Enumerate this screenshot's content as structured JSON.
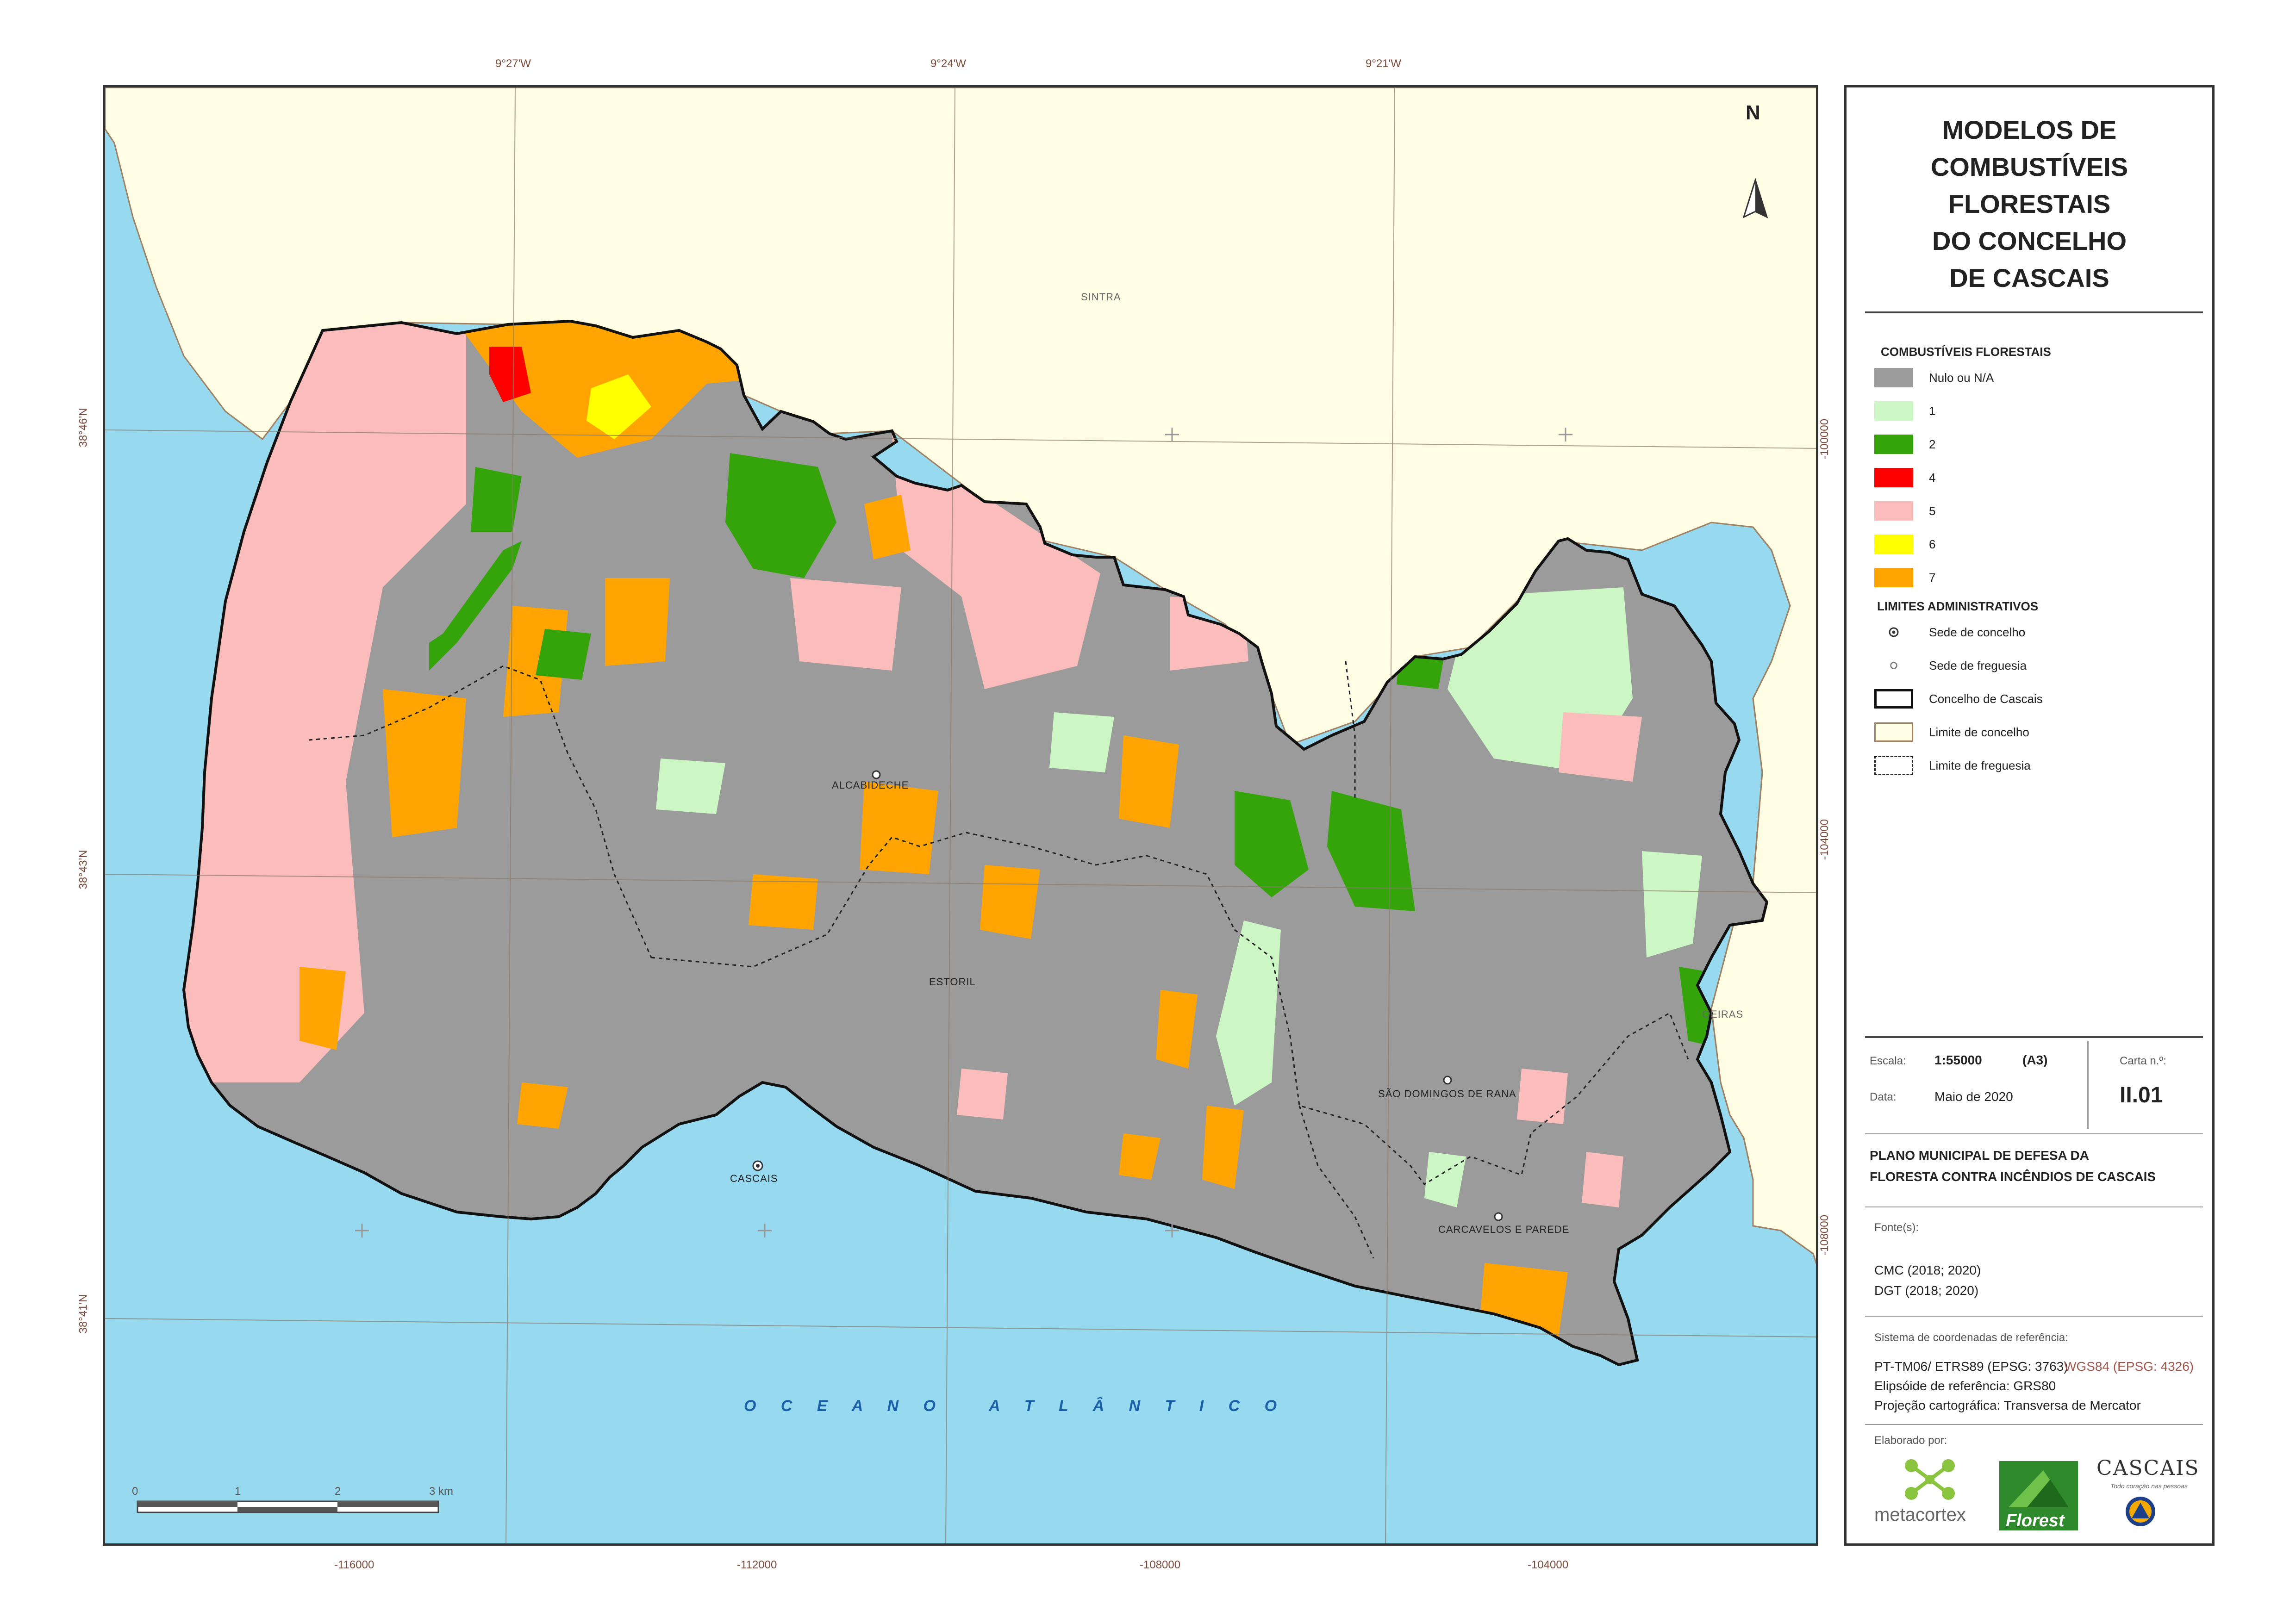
{
  "title_lines": [
    "MODELOS DE",
    "COMBUSTÍVEIS",
    "FLORESTAIS",
    "DO CONCELHO",
    "DE CASCAIS"
  ],
  "north_label": "N",
  "graticule": {
    "top_labels": [
      "9°27'W",
      "9°24'W",
      "9°21'W"
    ],
    "left_labels": [
      "38°46'N",
      "38°43'N",
      "38°41'N"
    ],
    "bottom_labels": [
      "-116000",
      "-112000",
      "-108000",
      "-104000"
    ],
    "right_labels": [
      "-100000",
      "-104000",
      "-108000"
    ]
  },
  "places": {
    "sintra": "SINTRA",
    "oeiras": "OEIRAS",
    "ocean": "O C E A N O   A T L Â N T I C O",
    "alcabideche": "ALCABIDECHE",
    "estoril": "ESTORIL",
    "cascais": "CASCAIS",
    "sao_domingos": "SÃO DOMINGOS DE RANA",
    "carcavelos": "CARCAVELOS E PAREDE"
  },
  "scalebar": {
    "ticks": [
      "0",
      "1",
      "2",
      "3 km"
    ]
  },
  "legend": {
    "fuel_header": "COMBUSTÍVEIS FLORESTAIS",
    "fuel_items": [
      {
        "label": "Nulo ou N/A",
        "color": "#9b9b9b"
      },
      {
        "label": "1",
        "color": "#ccf7c4"
      },
      {
        "label": "2",
        "color": "#35a30a"
      },
      {
        "label": "4",
        "color": "#ff0000"
      },
      {
        "label": "5",
        "color": "#fbbcbc"
      },
      {
        "label": "6",
        "color": "#ffff00"
      },
      {
        "label": "7",
        "color": "#ffa400"
      }
    ],
    "admin_header": "LIMITES ADMINISTRATIVOS",
    "admin_items": [
      {
        "label": "Sede de concelho",
        "symbol": "seat-municipality-icon"
      },
      {
        "label": "Sede de freguesia",
        "symbol": "seat-parish-icon"
      },
      {
        "label": "Concelho de Cascais",
        "symbol": "municipality-boundary"
      },
      {
        "label": "Limite de concelho",
        "symbol": "neighbor-boundary"
      },
      {
        "label": "Limite de freguesia",
        "symbol": "parish-boundary"
      }
    ]
  },
  "info": {
    "scale_label": "Escala:",
    "scale_value": "1:55000",
    "paper": "(A3)",
    "sheet_label": "Carta n.º:",
    "date_label": "Data:",
    "date_value": "Maio de 2020",
    "sheet_value": "II.01",
    "plan_line1": "PLANO MUNICIPAL DE DEFESA DA",
    "plan_line2": "FLORESTA CONTRA INCÊNDIOS DE CASCAIS",
    "sources_label": "Fonte(s):",
    "sources": [
      "CMC (2018; 2020)",
      "DGT (2018; 2020)"
    ],
    "crs_label": "Sistema de coordenadas de referência:",
    "crs_primary": "PT-TM06/ ETRS89 (EPSG: 3763)",
    "crs_secondary": "WGS84 (EPSG: 4326)",
    "ellipsoid": "Elipsóide de referência: GRS80",
    "projection": "Projeção cartográfica: Transversa de Mercator",
    "made_by": "Elaborado por:",
    "logo_metacortex": "metacortex",
    "logo_florest": "Florest",
    "logo_cascais": "CASCAIS",
    "logo_cascais_tagline": "Todo coração nas pessoas"
  },
  "colors": {
    "sea": "#97d9ef",
    "land": "#fffde4",
    "neighbor_border": "#a08060",
    "nulo": "#9b9b9b",
    "m1": "#ccf7c4",
    "m2": "#35a30a",
    "m4": "#ff0000",
    "m5": "#fbbcbc",
    "m6": "#ffff00",
    "m7": "#ffa400"
  }
}
